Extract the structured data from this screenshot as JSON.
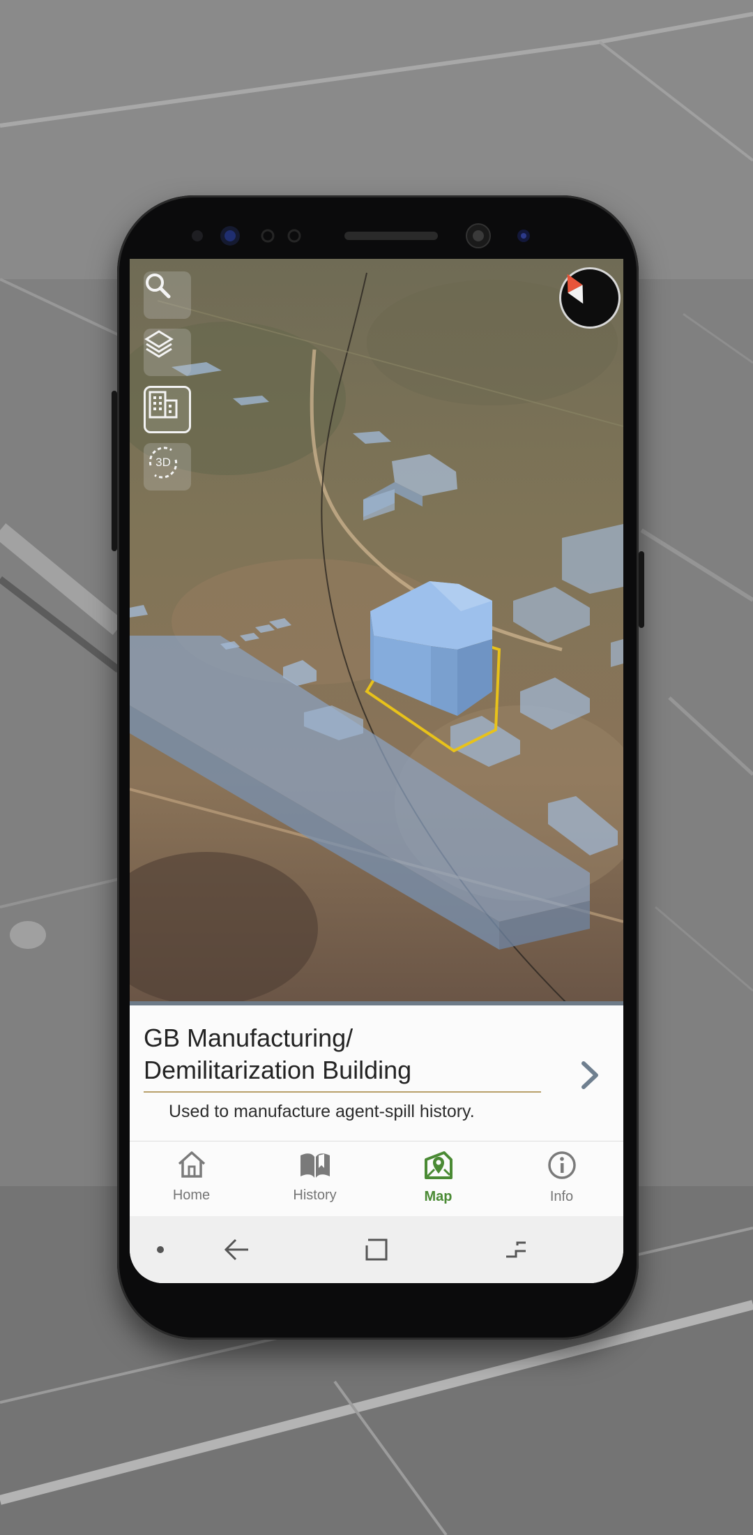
{
  "map": {
    "toolbar": [
      {
        "icon": "search-icon"
      },
      {
        "icon": "layers-icon"
      },
      {
        "icon": "buildings-icon",
        "active": true
      },
      {
        "icon": "3d-rotate-icon",
        "label": "3D"
      }
    ],
    "compass": {
      "icon": "compass-icon"
    }
  },
  "card": {
    "title_line1": "GB Manufacturing/",
    "title_line2": "Demilitarization Building",
    "subtitle": "Used to manufacture agent-spill history.",
    "chevron_icon": "chevron-right-icon"
  },
  "tabs": [
    {
      "label": "Home",
      "icon": "home-icon",
      "active": false
    },
    {
      "label": "History",
      "icon": "book-icon",
      "active": false
    },
    {
      "label": "Map",
      "icon": "map-pin-icon",
      "active": true
    },
    {
      "label": "Info",
      "icon": "info-icon",
      "active": false
    }
  ],
  "system_nav": {
    "items": [
      "dot-icon",
      "back-icon",
      "recents-icon",
      "home-gesture-icon"
    ]
  },
  "colors": {
    "accent": "#4a8a34",
    "selected_outline": "#e8c21a",
    "building_fill": "#8fb4e0",
    "title_rule": "#b8a06a"
  }
}
